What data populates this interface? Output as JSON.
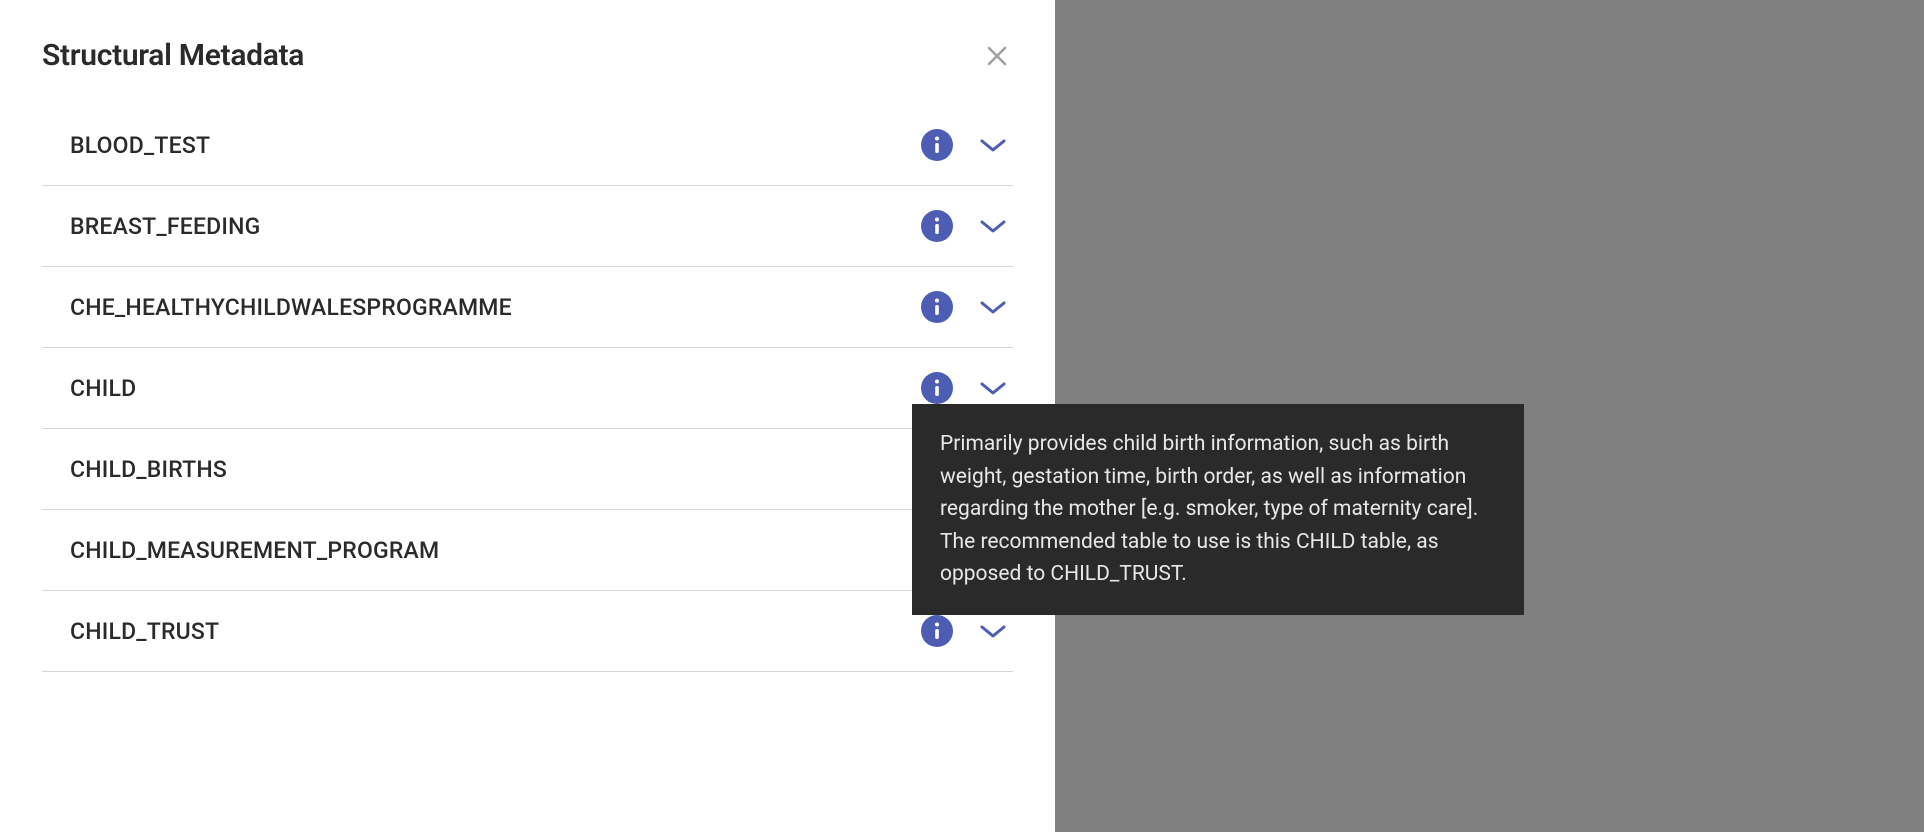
{
  "modal": {
    "title": "Structural Metadata"
  },
  "items": [
    {
      "label": "BLOOD_TEST"
    },
    {
      "label": "BREAST_FEEDING"
    },
    {
      "label": "CHE_HEALTHYCHILDWALESPROGRAMME"
    },
    {
      "label": "CHILD"
    },
    {
      "label": "CHILD_BIRTHS"
    },
    {
      "label": "CHILD_MEASUREMENT_PROGRAM"
    },
    {
      "label": "CHILD_TRUST"
    }
  ],
  "tooltip": {
    "text": "Primarily provides child birth information, such as birth weight, gestation time, birth order, as well as information regarding the mother [e.g. smoker, type of maternity care]. The recommended table to use is this CHILD table, as opposed to CHILD_TRUST."
  }
}
